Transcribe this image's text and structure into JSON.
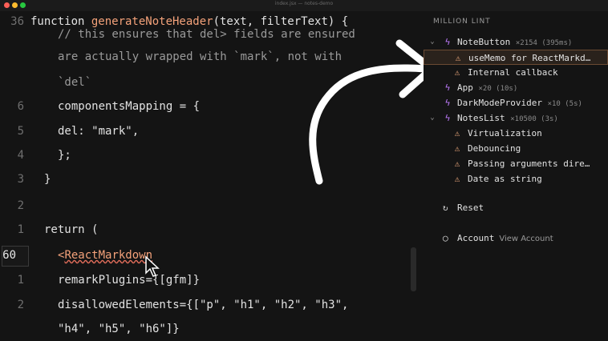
{
  "window": {
    "title": "index.jsx — notes-demo"
  },
  "editor": {
    "lines": [
      {
        "num": "36",
        "text_parts": [
          [
            "function ",
            ""
          ],
          [
            "generateNoteHeader",
            "fn"
          ],
          [
            "(text, filterText) {",
            ""
          ]
        ]
      },
      {
        "num": "",
        "text_parts": [
          [
            "  // this ensures that del> fields are ensured",
            "comment"
          ]
        ]
      },
      {
        "num": "",
        "text_parts": [
          [
            "  are actually wrapped with `mark`, not with",
            "comment"
          ]
        ]
      },
      {
        "num": "",
        "text_parts": [
          [
            "  `del`",
            "comment"
          ]
        ]
      },
      {
        "num": "6",
        "text_parts": [
          [
            "  componentsMapping = {",
            ""
          ]
        ]
      },
      {
        "num": "5",
        "text_parts": [
          [
            "    del: \"mark\",",
            ""
          ]
        ]
      },
      {
        "num": "4",
        "text_parts": [
          [
            "  };",
            ""
          ]
        ]
      },
      {
        "num": "3",
        "text_parts": [
          [
            "}",
            ""
          ]
        ]
      },
      {
        "num": "2",
        "text_parts": [
          [
            "",
            ""
          ]
        ]
      },
      {
        "num": "1",
        "text_parts": [
          [
            "return (",
            ""
          ]
        ]
      },
      {
        "num": "60",
        "text_parts": [
          [
            "  <",
            "tag"
          ],
          [
            "ReactMarkdown",
            "tag"
          ]
        ]
      },
      {
        "num": "1",
        "text_parts": [
          [
            "    remarkPlugins={[gfm]}",
            ""
          ]
        ]
      },
      {
        "num": "2",
        "text_parts": [
          [
            "    disallowedElements={[\"p\", \"h1\", \"h2\", \"h3\",",
            ""
          ]
        ]
      },
      {
        "num": "",
        "text_parts": [
          [
            "    \"h4\", \"h5\", \"h6\"]}",
            ""
          ]
        ]
      }
    ]
  },
  "panel": {
    "title": "MILLION LINT",
    "rows": [
      {
        "kind": "component",
        "expanded": true,
        "name": "NoteButton",
        "meta": "×2154 (395ms)"
      },
      {
        "kind": "issue",
        "name": "useMemo for ReactMarkd…",
        "selected": true
      },
      {
        "kind": "issue",
        "name": "Internal callback"
      },
      {
        "kind": "component",
        "expanded": false,
        "name": "App",
        "meta": "×20 (10s)"
      },
      {
        "kind": "component",
        "expanded": false,
        "name": "DarkModeProvider",
        "meta": "×10 (5s)"
      },
      {
        "kind": "component",
        "expanded": true,
        "name": "NotesList",
        "meta": "×10500 (3s)"
      },
      {
        "kind": "issue",
        "name": "Virtualization"
      },
      {
        "kind": "issue",
        "name": "Debouncing"
      },
      {
        "kind": "issue",
        "name": "Passing arguments dire…"
      },
      {
        "kind": "issue",
        "name": "Date as string"
      }
    ],
    "reset_label": "Reset",
    "account_label": "Account",
    "view_account_label": "View Account"
  },
  "colors": {
    "accent": "#f4a27a",
    "bolt": "#c07cff",
    "warning": "#e9a77b"
  },
  "icons": {
    "component": "bolt-icon",
    "issue": "warning-icon",
    "reset": "reset-icon",
    "account": "account-icon"
  }
}
